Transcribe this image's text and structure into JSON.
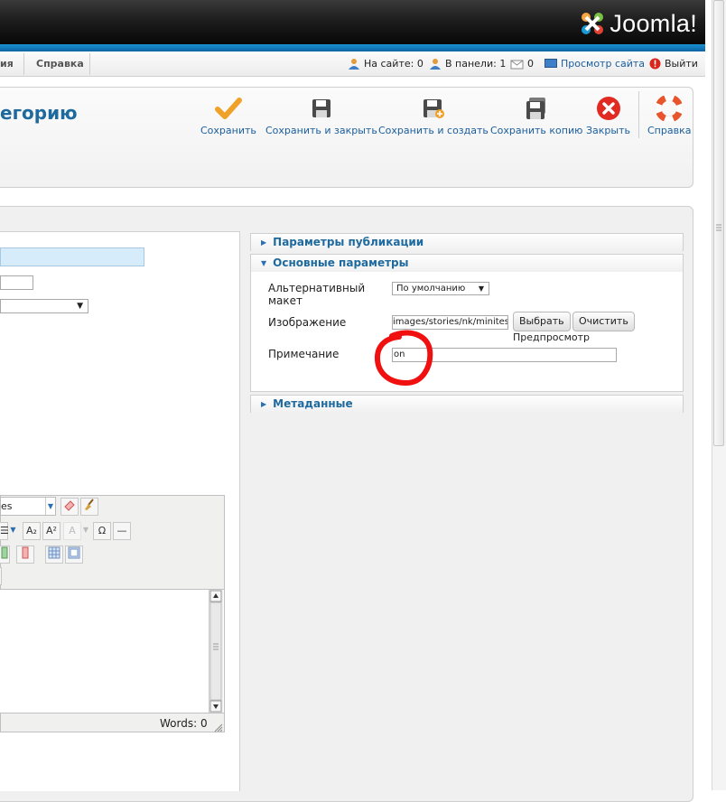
{
  "header": {
    "logo_text": "Joomla!",
    "colors": {
      "top": "#1c1c1c",
      "strip": "#1a91d2",
      "accent": "#1e6a9e"
    }
  },
  "menu": {
    "tabs": [
      "ия",
      "Справка"
    ]
  },
  "status": {
    "online": "На сайте: 0",
    "admins": "В панели: 1",
    "messages": "0",
    "view_site": "Просмотр сайта",
    "logout": "Выйти"
  },
  "page_title": "егорию",
  "toolbar": {
    "save": "Сохранить",
    "save_close": "Сохранить и закрыть",
    "save_new": "Сохранить и создать",
    "save_copy": "Сохранить копию",
    "close": "Закрыть",
    "help": "Справка"
  },
  "editor": {
    "font_select": "es",
    "words": "Words: 0"
  },
  "panels": {
    "publishing": "Параметры публикации",
    "basic": "Основные параметры",
    "metadata": "Метаданные"
  },
  "basic_params": {
    "layout_label": "Альтернативный макет",
    "layout_value": "По умолчанию",
    "image_label": "Изображение",
    "image_value": "images/stories/nk/minitest_s",
    "select_button": "Выбрать",
    "clear_button": "Очистить",
    "preview_label": "Предпросмотр",
    "note_label": "Примечание",
    "note_value": "on"
  }
}
